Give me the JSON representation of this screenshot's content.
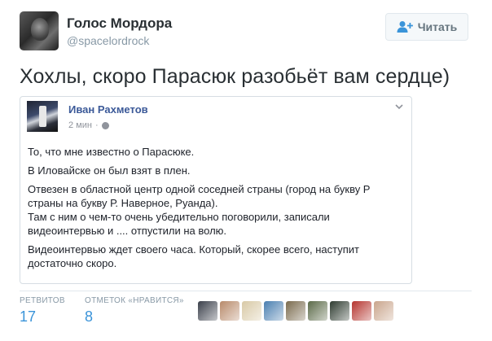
{
  "user": {
    "name": "Голос Мордора",
    "handle": "@spacelordrock"
  },
  "follow_button": {
    "label": "Читать",
    "icon": "user-plus-icon"
  },
  "tweet": {
    "text": "Хохлы, скоро Парасюк разобьёт вам сердце)"
  },
  "embedded_post": {
    "author": "Иван Рахметов",
    "time": "2 мин",
    "paragraphs": [
      "То, что мне известно о Парасюке.",
      "В Иловайске он был взят в плен.",
      "Отвезен в областной центр одной соседней страны (город на букву Р страны на букву Р. Наверное, Руанда).",
      "Там с ним о чем-то очень убедительно поговорили, записали видеоинтервью и .... отпустили на волю.",
      "Видеоинтервью ждет своего часа. Который, скорее всего, наступит достаточно скоро."
    ]
  },
  "stats": {
    "retweets_label": "РЕТВИТОВ",
    "retweets_count": "17",
    "likes_label": "ОТМЕТОК «НРАВИТСЯ»",
    "likes_count": "8"
  },
  "likers": [
    {
      "name": "liker-1",
      "color": "#3a3f4a"
    },
    {
      "name": "liker-2",
      "color": "#b88a6a"
    },
    {
      "name": "liker-3",
      "color": "#d8c9a6"
    },
    {
      "name": "liker-4",
      "color": "#4a7fb0"
    },
    {
      "name": "liker-5",
      "color": "#7a6b4e"
    },
    {
      "name": "liker-6",
      "color": "#5b6a48"
    },
    {
      "name": "liker-7",
      "color": "#2e3b30"
    },
    {
      "name": "liker-8",
      "color": "#b5342e"
    },
    {
      "name": "liker-9",
      "color": "#c9a58c"
    }
  ],
  "colors": {
    "link_blue": "#3b94d9",
    "fb_blue": "#3b5998",
    "muted": "#8899a6"
  }
}
